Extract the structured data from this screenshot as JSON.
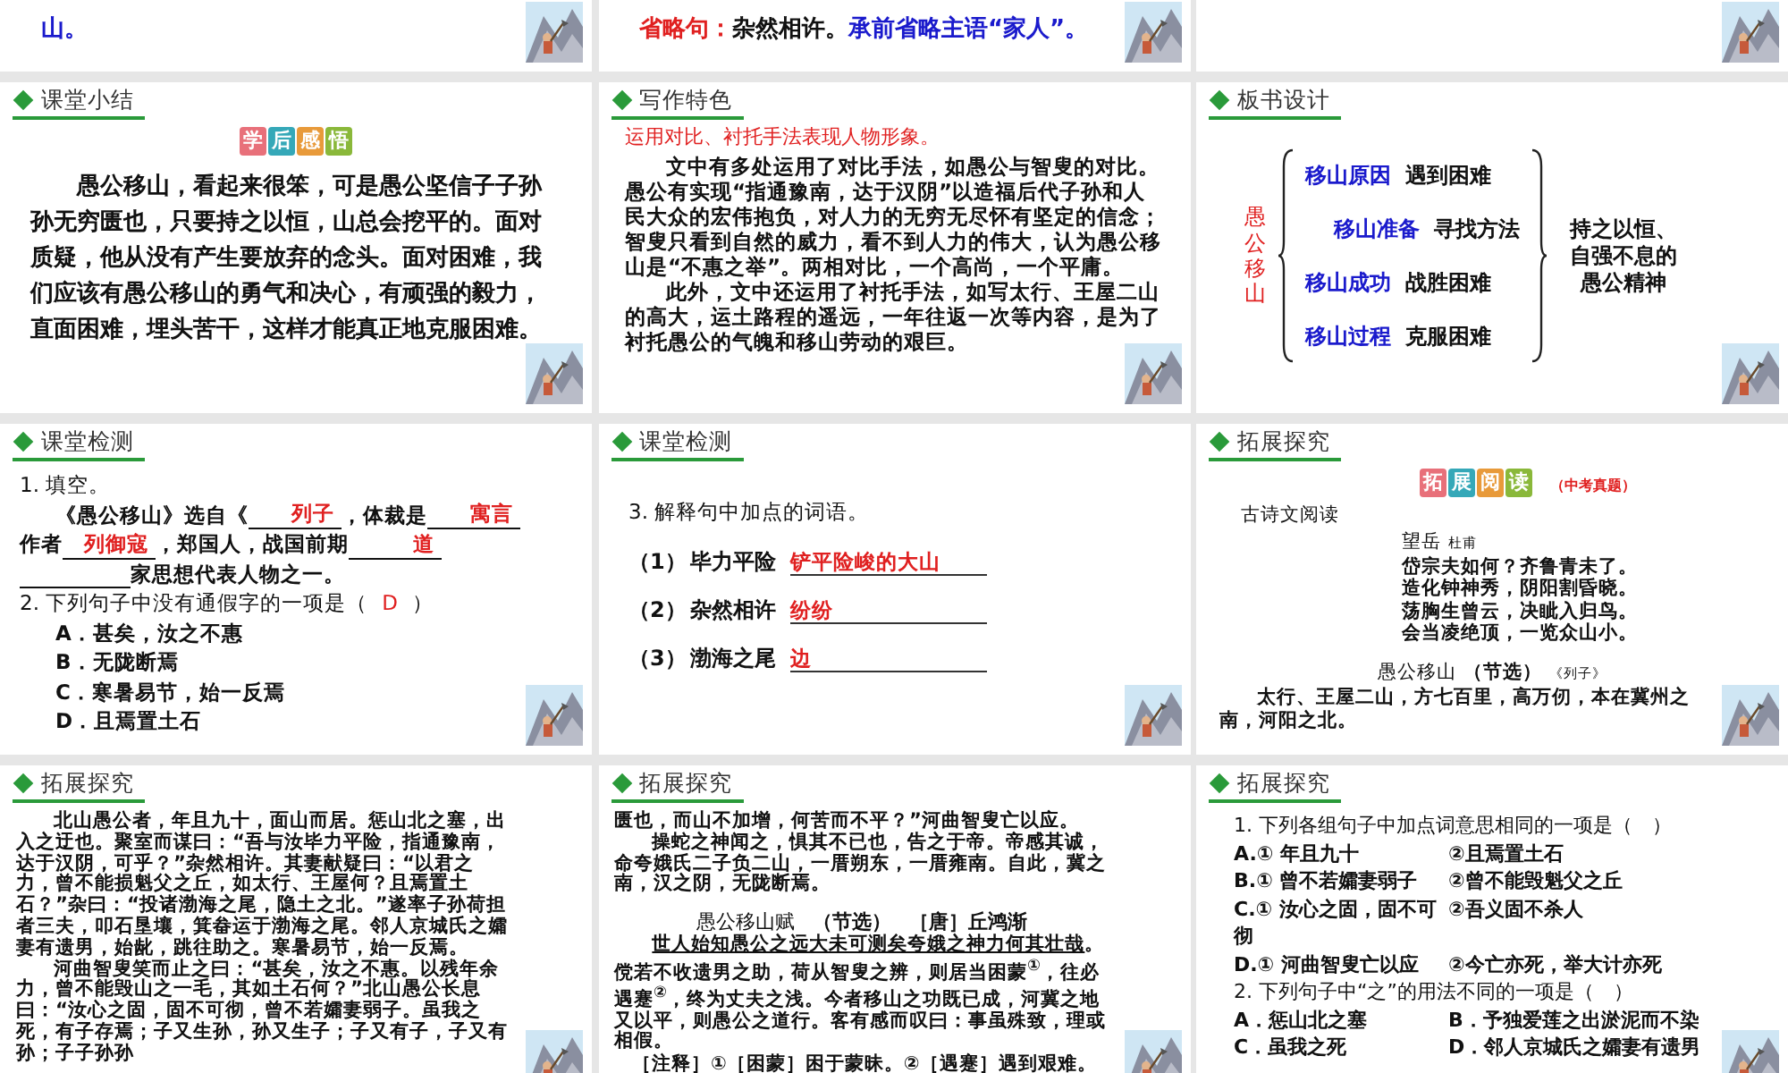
{
  "slides": [
    {
      "kind": "partial",
      "lines": [
        {
          "segments": [
            {
              "text": "山。",
              "color": "#1a1acc"
            }
          ]
        }
      ]
    },
    {
      "kind": "partial",
      "lines": [
        {
          "segments": [
            {
              "text": "省略句：",
              "color": "#e02020"
            },
            {
              "text": "杂然相许。",
              "color": "#111111"
            },
            {
              "text": "承前省略主语“家人”。",
              "color": "#1a1acc"
            }
          ]
        }
      ]
    },
    {
      "kind": "partial"
    },
    {
      "kind": "summary",
      "header": "课堂小结",
      "badge": [
        {
          "char": "学",
          "color": "#e8707a"
        },
        {
          "char": "后",
          "color": "#35a8b8"
        },
        {
          "char": "感",
          "color": "#e89a3a"
        },
        {
          "char": "悟",
          "color": "#8ab83a"
        }
      ],
      "paragraphs": [
        {
          "kind": "para",
          "indent": true,
          "segments": [
            {
              "text": "愚公移山，看起来很笨，可是愚公坚信子子孙孙无穷匮也，只要持之以恒，山总会挖平的。面对质疑，他从没有产生要放弃的念头。面对困难，我们应该有愚公移山的勇气和决心，有顽强的毅力，直面困难，埋头苦干，这样才能真正地克服困难。",
              "underlined": false
            }
          ]
        }
      ]
    },
    {
      "kind": "feature",
      "header": "写作特色",
      "subtitle": "运用对比、衬托手法表现人物形象。",
      "paragraphs": [
        {
          "kind": "para",
          "indent": true,
          "segments": [
            {
              "text": "文中有多处运用了对比手法，如愚公与智叟的对比。愚公有实现“指通豫南，达于汉阴”以造福后代子孙和人民大众的宏伟抱负，对人力的无穷无尽怀有坚定的信念；智叟只看到自然的威力，看不到人力的伟大，认为愚公移山是“不惠之举”。两相对比，一个高尚，一个平庸。",
              "underlined": false
            }
          ]
        },
        {
          "kind": "para",
          "indent": true,
          "segments": [
            {
              "text": "此外，文中还运用了衬托手法，如写太行、王屋二山的高大，运土路程的遥远，一年往返一次等内容，是为了衬托愚公的气魄和移山劳动的艰巨。",
              "underlined": false
            }
          ]
        }
      ]
    },
    {
      "kind": "board",
      "header": "板书设计",
      "subject": "愚公移山",
      "items": [
        {
          "topic": "移山原因",
          "note": "遇到困难",
          "shifted": false
        },
        {
          "topic": "移山准备",
          "note": "寻找方法",
          "shifted": true
        },
        {
          "topic": "移山成功",
          "note": "战胜困难",
          "shifted": false
        },
        {
          "topic": "移山过程",
          "note": "克服困难",
          "shifted": false
        }
      ],
      "conclusion": [
        "持之以恒、",
        "自强不息的",
        "愚公精神"
      ]
    },
    {
      "kind": "fill",
      "header": "课堂检测",
      "lines": [
        {
          "bold": false,
          "indent": false,
          "segments": [
            {
              "kind": "text",
              "text": "1. 填空。"
            }
          ]
        },
        {
          "bold": true,
          "indent": true,
          "segments": [
            {
              "kind": "text",
              "text": "《愚公移山》选自《"
            },
            {
              "kind": "answer",
              "text": "列子"
            },
            {
              "kind": "text",
              "text": "，体裁是 "
            },
            {
              "kind": "answer",
              "text": "寓言"
            }
          ]
        },
        {
          "bold": true,
          "indent": false,
          "segments": [
            {
              "kind": "text",
              "text": "作者"
            },
            {
              "kind": "answer",
              "text": "列御寇"
            },
            {
              "kind": "text",
              "text": "，郑国人，战国前期"
            },
            {
              "kind": "answer",
              "text": "道"
            }
          ]
        },
        {
          "bold": true,
          "indent": false,
          "segments": [
            {
              "kind": "blank"
            },
            {
              "kind": "text",
              "text": "家思想代表人物之一。"
            }
          ]
        },
        {
          "bold": false,
          "indent": false,
          "segments": [
            {
              "kind": "text",
              "text": "2. 下列句子中没有通假字的一项是（"
            },
            {
              "kind": "mark",
              "text": "D"
            },
            {
              "kind": "text",
              "text": "）"
            }
          ]
        },
        {
          "bold": true,
          "indent": true,
          "segments": [
            {
              "kind": "text",
              "text": "A．甚矣，汝之不惠"
            }
          ]
        },
        {
          "bold": true,
          "indent": true,
          "segments": [
            {
              "kind": "text",
              "text": "B．无陇断焉"
            }
          ]
        },
        {
          "bold": true,
          "indent": true,
          "segments": [
            {
              "kind": "text",
              "text": "C．寒暑易节，始一反焉"
            }
          ]
        },
        {
          "bold": true,
          "indent": true,
          "segments": [
            {
              "kind": "text",
              "text": "D．且焉置土石"
            }
          ]
        }
      ]
    },
    {
      "kind": "explain",
      "header": "课堂检测",
      "prompt": "3. 解释句中加点的词语。",
      "items": [
        {
          "label": "（1）",
          "word": "毕力平险",
          "answer": "铲平险峻的大山"
        },
        {
          "label": "（2）",
          "word": "杂然相许",
          "answer": "纷纷"
        },
        {
          "label": "（3）",
          "word": "渤海之尾",
          "answer": "边"
        }
      ]
    },
    {
      "kind": "reading",
      "header": "拓展探究",
      "badge": [
        {
          "char": "拓",
          "color": "#e8707a"
        },
        {
          "char": "展",
          "color": "#35a8b8"
        },
        {
          "char": "阅",
          "color": "#e89a3a"
        },
        {
          "char": "读",
          "color": "#8ab83a"
        }
      ],
      "note": "（中考真题）",
      "section": "古诗文阅读",
      "poem": {
        "title": "望岳",
        "author": "杜甫",
        "lines": [
          "岱宗夫如何？齐鲁青未了。",
          "造化钟神秀，阴阳割昏晓。",
          "荡胸生曾云，决眦入归鸟。",
          "会当凌绝顶，一览众山小。"
        ]
      },
      "excerpt": {
        "title": "愚公移山",
        "tag": "（节选）",
        "source": "《列子》",
        "text": "太行、王屋二山，方七百里，高万仞，本在冀州之南，河阳之北。"
      }
    },
    {
      "kind": "text",
      "header": "拓展探究",
      "paragraphs": [
        {
          "kind": "para",
          "indent": true,
          "segments": [
            {
              "text": "北山愚公者，年且九十，面山而居。惩山北之塞，出入之迂也。聚室而谋曰：“吾与汝毕力平险，指通豫南，达于汉阴，可乎？”杂然相许。其妻献疑曰：“以君之力，曾不能损魁父之丘，如太行、王屋何？且焉置土石？”杂曰：“投诸渤海之尾，隐土之北。”遂率子孙荷担者三夫，叩石垦壤，箕畚运于渤海之尾。邻人京城氏之孀妻有遗男，始龀，跳往助之。寒暑易节，始一反焉。",
              "underlined": false
            }
          ]
        },
        {
          "kind": "para",
          "indent": true,
          "segments": [
            {
              "text": "河曲智叟笑而止之曰：“甚矣，汝之不惠。以残年余力，曾不能毁山之一毛，其如土石何？”北山愚公长息曰：“汝心之固，固不可彻，曾不若孀妻弱子。虽我之死，有子存焉；子又生孙，孙又生子；子又有子，子又有孙；子子孙孙",
              "underlined": false
            }
          ]
        }
      ]
    },
    {
      "kind": "text",
      "header": "拓展探究",
      "paragraphs": [
        {
          "kind": "para",
          "indent": false,
          "segments": [
            {
              "text": "匮也，而山不加增，何苦而不平？”河曲智叟亡以应。",
              "underlined": false
            }
          ]
        },
        {
          "kind": "para",
          "indent": true,
          "segments": [
            {
              "text": "操蛇之神闻之，惧其不已也，告之于帝。帝感其诚，命夸娥氏二子负二山，一厝朔东，一厝雍南。自此，冀之南，汉之阴，无陇断焉。",
              "underlined": false
            }
          ]
        },
        {
          "kind": "title",
          "parts": [
            "愚公移山赋",
            "（节选）",
            "［唐］丘鸿渐"
          ]
        },
        {
          "kind": "para",
          "indent": true,
          "segments": [
            {
              "text": "世人始知愚公之远大未可测矣夸娥之神力何其壮哉",
              "underlined": true
            },
            {
              "text": "。傥若不收遗男之助，荷从智叟之辨，则居当困蒙$^{①}$，往必遇蹇$^{②}$，终为丈夫之浅。今者移山之功既已成，河冀之地又以平，则愚公之道行。客有感而叹曰：事虽殊致，理或相假。",
              "underlined": false
            }
          ]
        },
        {
          "kind": "note",
          "text": "［注释］①［困蒙］困于蒙昧。②［遇蹇］遇到艰难。"
        }
      ]
    },
    {
      "kind": "quiz",
      "header": "拓展探究",
      "lines": [
        {
          "kind": "question",
          "text": "1. 下列各组句子中加点词意思相同的一项是（　）"
        },
        {
          "kind": "options",
          "options": [
            "A.① 年且九十",
            "②且焉置土石"
          ]
        },
        {
          "kind": "options",
          "options": [
            "B.① 曾不若孀妻弱子",
            "②曾不能毁魁父之丘"
          ]
        },
        {
          "kind": "options",
          "options": [
            "C.① 汝心之固，固不可彻",
            "②吾义固不杀人"
          ]
        },
        {
          "kind": "options",
          "options": [
            "D.① 河曲智叟亡以应",
            "②今亡亦死，举大计亦死"
          ]
        },
        {
          "kind": "question",
          "text": "2. 下列句子中“之”的用法不同的一项是（　）"
        },
        {
          "kind": "options",
          "options": [
            "A．惩山北之塞",
            "B．予独爱莲之出淤泥而不染"
          ]
        },
        {
          "kind": "options",
          "options": [
            "C．虽我之死",
            "D．邻人京城氏之孀妻有遗男"
          ]
        }
      ]
    }
  ]
}
